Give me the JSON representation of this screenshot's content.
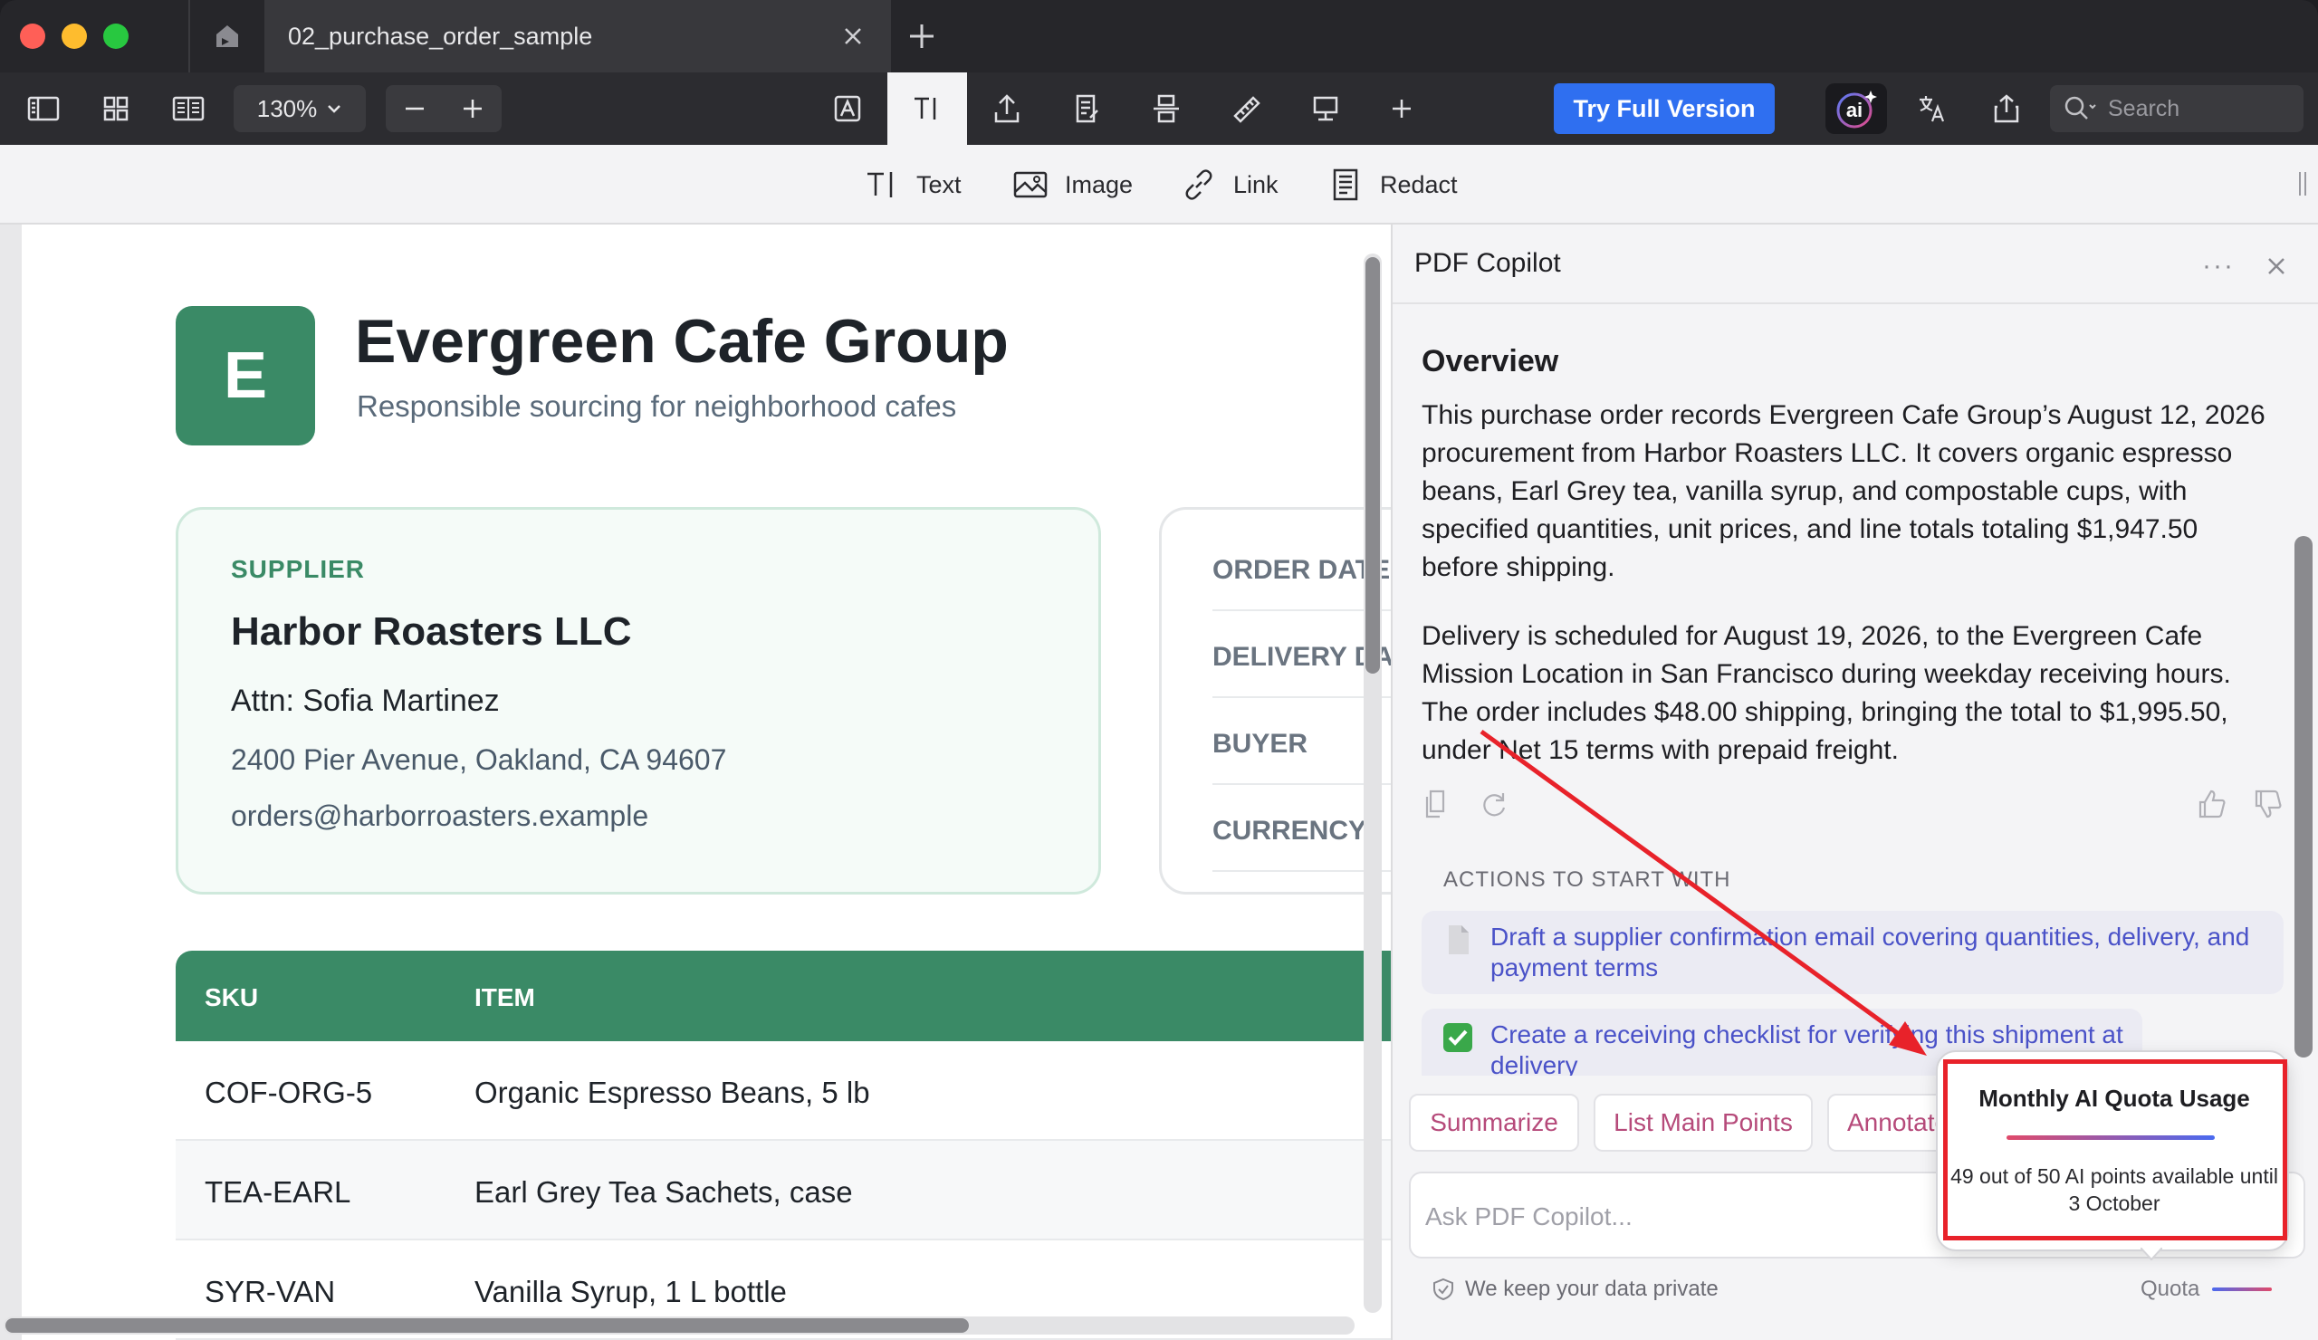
{
  "window": {
    "tab_title": "02_purchase_order_sample"
  },
  "toolbar": {
    "zoom": "130%",
    "try_full_version": "Try Full Version",
    "ai_label": "ai",
    "search_placeholder": "Search"
  },
  "edit_toolbar": {
    "text": "Text",
    "image": "Image",
    "link": "Link",
    "redact": "Redact"
  },
  "document": {
    "logo_letter": "E",
    "company_name": "Evergreen Cafe Group",
    "tagline": "Responsible sourcing for neighborhood cafes",
    "supplier": {
      "label": "SUPPLIER",
      "name": "Harbor Roasters LLC",
      "attn": "Attn: Sofia Martinez",
      "address": "2400 Pier Avenue, Oakland, CA 94607",
      "email": "orders@harborroasters.example"
    },
    "meta": [
      "ORDER DATE",
      "DELIVERY DATE",
      "BUYER",
      "CURRENCY"
    ],
    "table": {
      "headers": [
        "SKU",
        "ITEM"
      ],
      "rows": [
        [
          "COF-ORG-5",
          "Organic Espresso Beans, 5 lb"
        ],
        [
          "TEA-EARL",
          "Earl Grey Tea Sachets, case"
        ],
        [
          "SYR-VAN",
          "Vanilla Syrup, 1 L bottle"
        ]
      ]
    }
  },
  "copilot": {
    "title": "PDF Copilot",
    "more": "···",
    "overview_title": "Overview",
    "para1": "This purchase order records Evergreen Cafe Group’s August 12, 2026 procurement from Harbor Roasters LLC. It covers organic espresso beans, Earl Grey tea, vanilla syrup, and compostable cups, with specified quantities, unit prices, and line totals totaling $1,947.50 before shipping.",
    "para2": "Delivery is scheduled for August 19, 2026, to the Evergreen Cafe Mission Location in San Francisco during weekday receiving hours. The order includes $48.00 shipping, bringing the total to $1,995.50, under Net 15 terms with prepaid freight.",
    "actions_label": "ACTIONS TO START WITH",
    "actions": [
      "Draft a supplier confirmation email covering quantities, delivery, and payment terms",
      "Create a receiving checklist for verifying this shipment at delivery"
    ],
    "chips": [
      "Summarize",
      "List Main Points",
      "Annotate"
    ],
    "input_placeholder": "Ask PDF Copilot...",
    "privacy": "We keep your data private",
    "quota_label": "Quota"
  },
  "quota_popover": {
    "title": "Monthly AI Quota Usage",
    "text": "49 out of 50 AI points available until 3 October",
    "points_available": 49,
    "points_total": 50
  },
  "colors": {
    "accent_green": "#3a8a66",
    "primary_blue": "#2f6ff0",
    "annotation_red": "#e8222a",
    "action_link": "#4a52c8",
    "chip_text": "#b64a7a"
  }
}
